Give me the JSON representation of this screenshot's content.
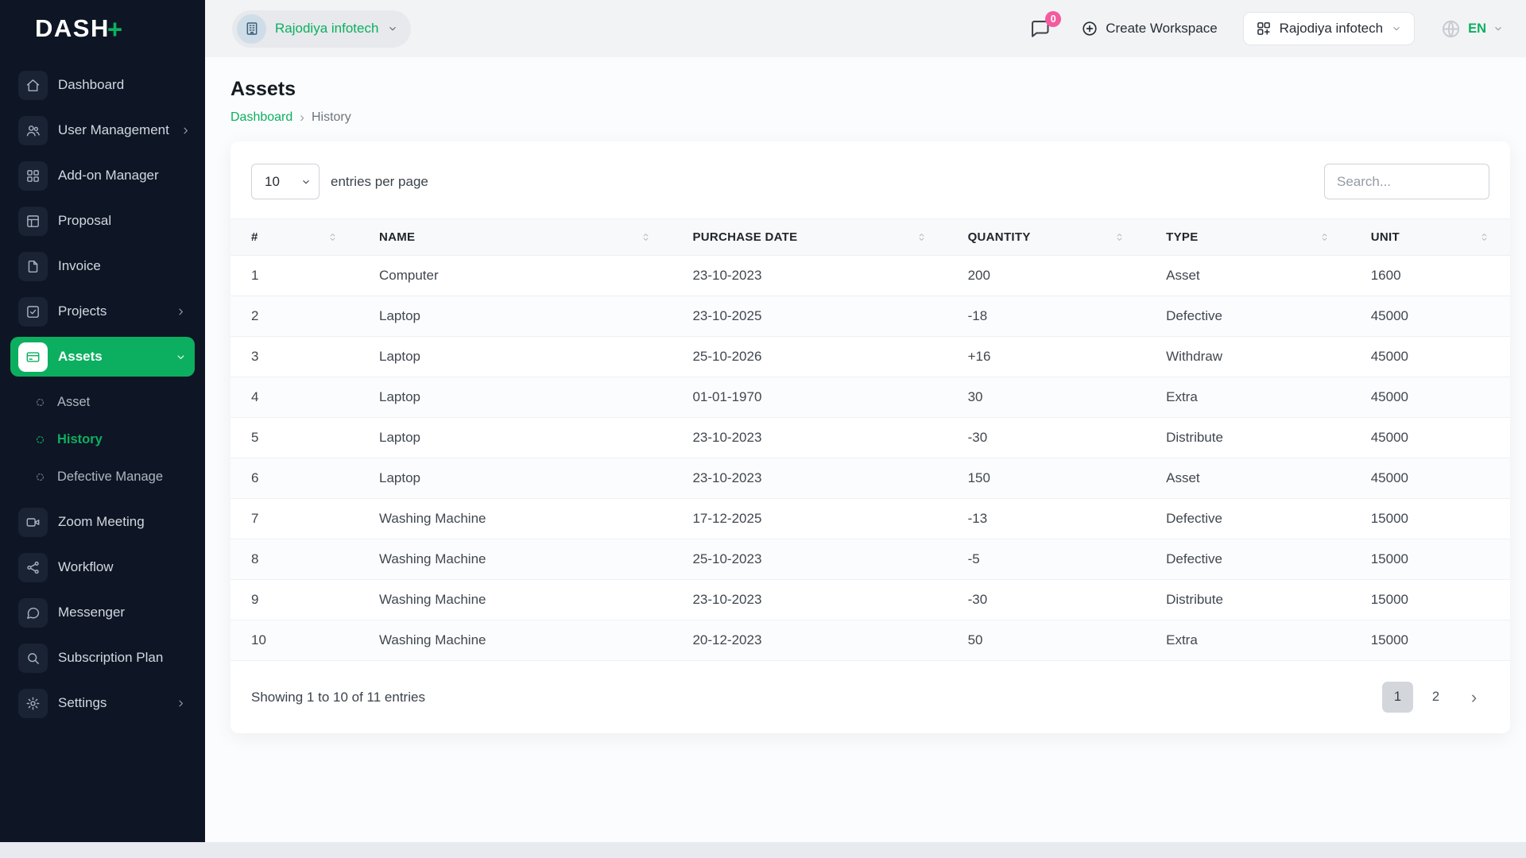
{
  "colors": {
    "accent_green": "#0caf60",
    "sidebar_background": "#0e1524",
    "badge_pink": "#f45b9e"
  },
  "brand": {
    "name": "DASH",
    "plus": "+"
  },
  "topbar": {
    "workspace_switcher": {
      "icon": "building-icon",
      "label": "Rajodiya infotech"
    },
    "messages": {
      "icon": "chat-icon",
      "badge": "0"
    },
    "create_workspace": {
      "icon": "plus-circle-icon",
      "label": "Create Workspace"
    },
    "workspace_menu": {
      "icon": "grid-plus-icon",
      "label": "Rajodiya infotech"
    },
    "language": {
      "icon": "globe-icon",
      "label": "EN"
    }
  },
  "sidebar": {
    "items": [
      {
        "label": "Dashboard",
        "icon": "home-icon",
        "chevron": false,
        "active": false
      },
      {
        "label": "User Management",
        "icon": "users-icon",
        "chevron": true,
        "active": false
      },
      {
        "label": "Add-on Manager",
        "icon": "grid-icon",
        "chevron": false,
        "active": false
      },
      {
        "label": "Proposal",
        "icon": "layout-icon",
        "chevron": false,
        "active": false
      },
      {
        "label": "Invoice",
        "icon": "file-icon",
        "chevron": false,
        "active": false
      },
      {
        "label": "Projects",
        "icon": "check-square-icon",
        "chevron": true,
        "active": false
      },
      {
        "label": "Assets",
        "icon": "card-icon",
        "chevron": true,
        "active": true,
        "submenu": [
          {
            "label": "Asset",
            "active": false
          },
          {
            "label": "History",
            "active": true
          },
          {
            "label": "Defective Manage",
            "active": false
          }
        ]
      },
      {
        "label": "Zoom Meeting",
        "icon": "video-icon",
        "chevron": false,
        "active": false
      },
      {
        "label": "Workflow",
        "icon": "share-icon",
        "chevron": false,
        "active": false
      },
      {
        "label": "Messenger",
        "icon": "message-icon",
        "chevron": false,
        "active": false
      },
      {
        "label": "Subscription Plan",
        "icon": "search-icon",
        "chevron": false,
        "active": false
      },
      {
        "label": "Settings",
        "icon": "gear-icon",
        "chevron": true,
        "active": false
      }
    ]
  },
  "page": {
    "title": "Assets",
    "breadcrumb": {
      "link": "Dashboard",
      "separator": "›",
      "current": "History"
    }
  },
  "controls": {
    "entries_value": "10",
    "entries_label": "entries per page",
    "search_placeholder": "Search..."
  },
  "table": {
    "columns": [
      "#",
      "NAME",
      "PURCHASE DATE",
      "QUANTITY",
      "TYPE",
      "UNIT"
    ],
    "rows": [
      [
        "1",
        "Computer",
        "23-10-2023",
        "200",
        "Asset",
        "1600"
      ],
      [
        "2",
        "Laptop",
        "23-10-2025",
        "-18",
        "Defective",
        "45000"
      ],
      [
        "3",
        "Laptop",
        "25-10-2026",
        "+16",
        "Withdraw",
        "45000"
      ],
      [
        "4",
        "Laptop",
        "01-01-1970",
        "30",
        "Extra",
        "45000"
      ],
      [
        "5",
        "Laptop",
        "23-10-2023",
        "-30",
        "Distribute",
        "45000"
      ],
      [
        "6",
        "Laptop",
        "23-10-2023",
        "150",
        "Asset",
        "45000"
      ],
      [
        "7",
        "Washing Machine",
        "17-12-2025",
        "-13",
        "Defective",
        "15000"
      ],
      [
        "8",
        "Washing Machine",
        "25-10-2023",
        "-5",
        "Defective",
        "15000"
      ],
      [
        "9",
        "Washing Machine",
        "23-10-2023",
        "-30",
        "Distribute",
        "15000"
      ],
      [
        "10",
        "Washing Machine",
        "20-12-2023",
        "50",
        "Extra",
        "15000"
      ]
    ]
  },
  "footer": {
    "showing": "Showing 1 to 10 of 11 entries",
    "pages": [
      {
        "label": "1",
        "active": true
      },
      {
        "label": "2",
        "active": false
      }
    ],
    "next": "›"
  }
}
